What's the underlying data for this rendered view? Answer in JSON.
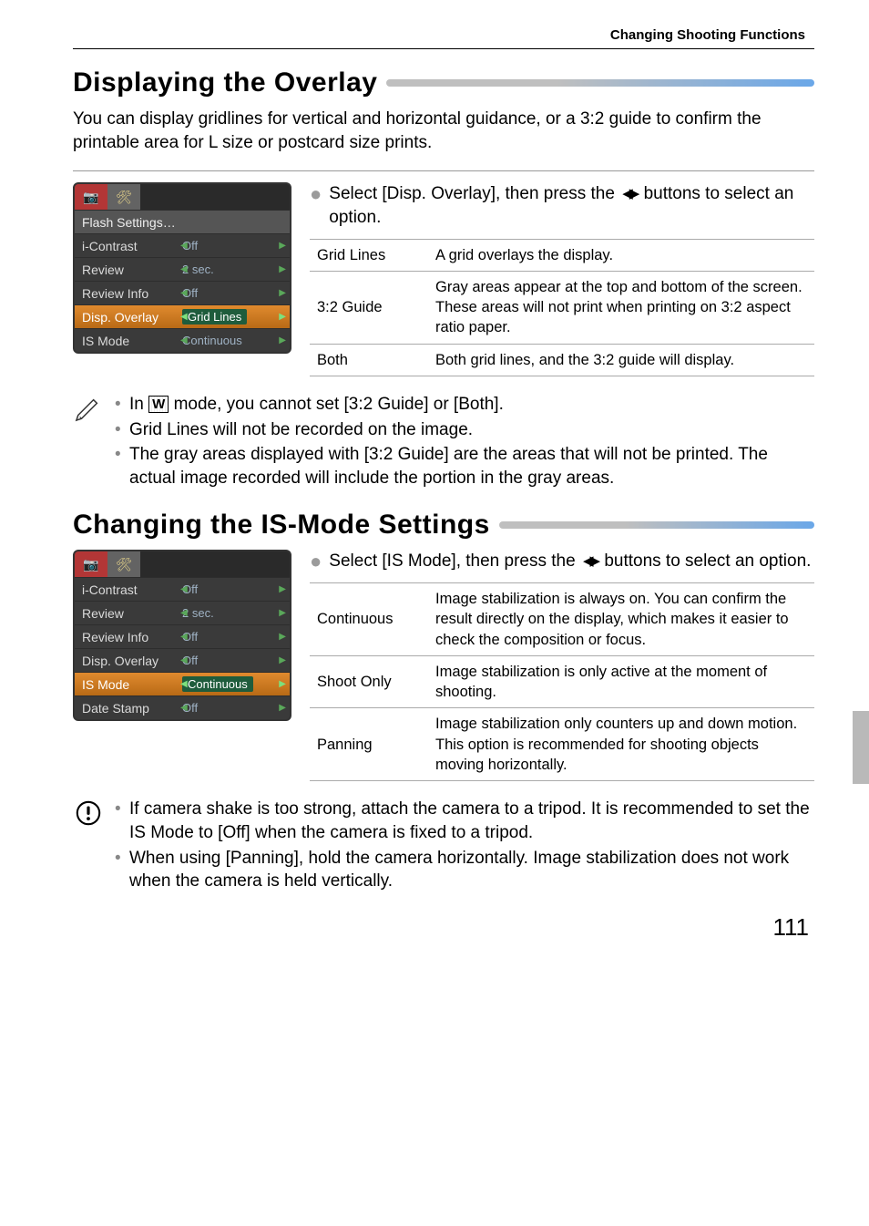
{
  "header": {
    "category": "Changing Shooting Functions"
  },
  "overlay": {
    "title": "Displaying the Overlay",
    "intro": "You can display gridlines for vertical and horizontal guidance, or a 3:2 guide to confirm the printable area for L size or postcard size prints.",
    "screenshot": {
      "tabs": [
        "📷",
        "🛠"
      ],
      "rows": [
        {
          "label": "Flash Settings…",
          "value": "",
          "type": "section"
        },
        {
          "label": "i-Contrast",
          "value": "Off"
        },
        {
          "label": "Review",
          "value": "2 sec."
        },
        {
          "label": "Review Info",
          "value": "Off"
        },
        {
          "label": "Disp. Overlay",
          "value": "Grid Lines",
          "highlight": true
        },
        {
          "label": "IS Mode",
          "value": "Continuous"
        }
      ]
    },
    "instruction_a": "Select [Disp. Overlay], then press the ",
    "instruction_b": " buttons to select an option.",
    "table": [
      {
        "name": "Grid Lines",
        "desc": "A grid overlays the display."
      },
      {
        "name": "3:2 Guide",
        "desc": "Gray areas appear at the top and bottom of the screen. These areas will not print when printing on 3:2 aspect ratio paper."
      },
      {
        "name": "Both",
        "desc": "Both grid lines, and the 3:2 guide will display."
      }
    ],
    "notes": [
      {
        "pre": "In ",
        "mid": " mode, you cannot set [3:2 Guide] or [Both].",
        "wicon": true
      },
      {
        "text": "Grid Lines will not be recorded on the image."
      },
      {
        "text": "The gray areas displayed with [3:2 Guide] are the areas that will not be printed. The actual image recorded will include the portion in the gray areas."
      }
    ]
  },
  "ismode": {
    "title": "Changing the IS-Mode Settings",
    "screenshot": {
      "tabs": [
        "📷",
        "🛠"
      ],
      "rows": [
        {
          "label": "i-Contrast",
          "value": "Off"
        },
        {
          "label": "Review",
          "value": "2 sec."
        },
        {
          "label": "Review Info",
          "value": "Off"
        },
        {
          "label": "Disp. Overlay",
          "value": "Off"
        },
        {
          "label": "IS Mode",
          "value": "Continuous",
          "highlight": true
        },
        {
          "label": "Date Stamp",
          "value": "Off"
        }
      ]
    },
    "instruction_a": "Select [IS Mode], then press the ",
    "instruction_b": " buttons to select an option.",
    "table": [
      {
        "name": "Continuous",
        "desc": "Image stabilization is always on. You can confirm the result directly on the display, which makes it easier to check the composition or focus."
      },
      {
        "name": "Shoot Only",
        "desc": "Image stabilization is only active at the moment of shooting."
      },
      {
        "name": "Panning",
        "desc": "Image stabilization only counters up and down motion. This option is recommended for shooting objects moving horizontally."
      }
    ],
    "notes": [
      {
        "text": "If camera shake is too strong, attach the camera to a tripod. It is recommended to set the IS Mode to [Off] when the camera is fixed to a tripod."
      },
      {
        "text": "When using [Panning], hold the camera horizontally. Image stabilization does not work when the camera is held vertically."
      }
    ]
  },
  "page": "111"
}
